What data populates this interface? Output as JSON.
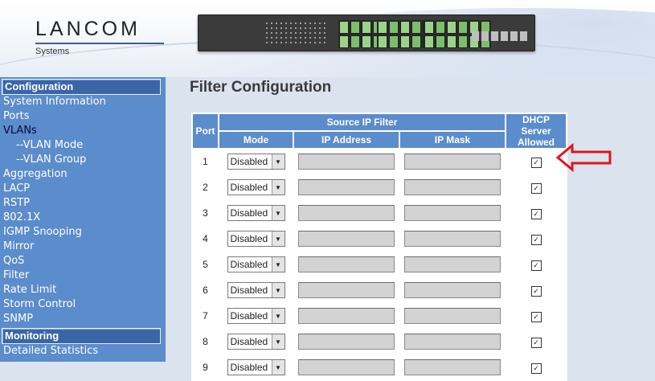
{
  "header": {
    "logo_text": "LANCOM",
    "logo_sub": "Systems"
  },
  "sidebar": {
    "sections": [
      {
        "title": "Configuration",
        "items": [
          {
            "label": "System Information",
            "sub": false
          },
          {
            "label": "Ports",
            "sub": false
          },
          {
            "label": "VLANs",
            "sub": false,
            "active": true
          },
          {
            "label": "--VLAN Mode",
            "sub": true
          },
          {
            "label": "--VLAN Group",
            "sub": true
          },
          {
            "label": "Aggregation",
            "sub": false
          },
          {
            "label": "LACP",
            "sub": false
          },
          {
            "label": "RSTP",
            "sub": false
          },
          {
            "label": "802.1X",
            "sub": false
          },
          {
            "label": "IGMP Snooping",
            "sub": false
          },
          {
            "label": "Mirror",
            "sub": false
          },
          {
            "label": "QoS",
            "sub": false
          },
          {
            "label": "Filter",
            "sub": false
          },
          {
            "label": "Rate Limit",
            "sub": false
          },
          {
            "label": "Storm Control",
            "sub": false
          },
          {
            "label": "SNMP",
            "sub": false
          }
        ]
      },
      {
        "title": "Monitoring",
        "items": [
          {
            "label": "Detailed Statistics",
            "sub": false
          }
        ]
      }
    ]
  },
  "main": {
    "title": "Filter Configuration",
    "table": {
      "headers": {
        "port": "Port",
        "source_ip_filter": "Source IP Filter",
        "mode": "Mode",
        "ip_address": "IP Address",
        "ip_mask": "IP Mask",
        "dhcp_line1": "DHCP Server",
        "dhcp_line2": "Allowed"
      },
      "rows": [
        {
          "port": "1",
          "mode": "Disabled",
          "ip": "",
          "mask": "",
          "dhcp": true
        },
        {
          "port": "2",
          "mode": "Disabled",
          "ip": "",
          "mask": "",
          "dhcp": true
        },
        {
          "port": "3",
          "mode": "Disabled",
          "ip": "",
          "mask": "",
          "dhcp": true
        },
        {
          "port": "4",
          "mode": "Disabled",
          "ip": "",
          "mask": "",
          "dhcp": true
        },
        {
          "port": "5",
          "mode": "Disabled",
          "ip": "",
          "mask": "",
          "dhcp": true
        },
        {
          "port": "6",
          "mode": "Disabled",
          "ip": "",
          "mask": "",
          "dhcp": true
        },
        {
          "port": "7",
          "mode": "Disabled",
          "ip": "",
          "mask": "",
          "dhcp": true
        },
        {
          "port": "8",
          "mode": "Disabled",
          "ip": "",
          "mask": "",
          "dhcp": true
        },
        {
          "port": "9",
          "mode": "Disabled",
          "ip": "",
          "mask": "",
          "dhcp": true
        }
      ]
    }
  },
  "colors": {
    "sidebar_bg": "#5b8ccc",
    "header_cell": "#5b8ccc",
    "annotation_arrow": "#e0141e"
  }
}
